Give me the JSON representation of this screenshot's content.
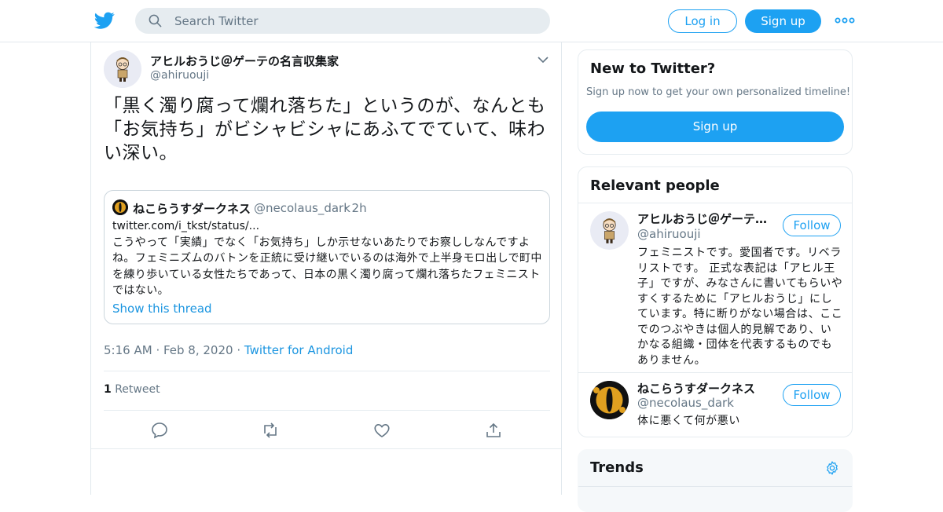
{
  "header": {
    "search_placeholder": "Search Twitter",
    "login_label": "Log in",
    "signup_label": "Sign up",
    "brand_color": "#1da1f2"
  },
  "tweet": {
    "author_name": "アヒルおうじ＠ゲーテの名言収集家",
    "author_handle": "@ahiruouji",
    "text": "「黒く濁り腐って爛れ落ちた」というのが、なんとも「お気持ち」がビシャビシャにあふてでていて、味わい深い。",
    "quote": {
      "author_name": "ねこらうすダークネス",
      "author_handle": "@necolaus_dark",
      "time": "2h",
      "link": "twitter.com/i_tkst/status/...",
      "text": "こうやって「実績」でなく「お気持ち」しか示せないあたりでお察ししなんですよね。フェミニズムのバトンを正統に受け継いでいるのは海外で上半身モロ出しで町中を練り歩いている女性たちであって、日本の黒く濁り腐って爛れ落ちたフェミニストではない。",
      "show_thread": "Show this thread"
    },
    "time": "5:16 AM",
    "date": "Feb 8, 2020",
    "source": "Twitter for Android",
    "retweet_count": "1",
    "retweet_label": "Retweet"
  },
  "sidebar": {
    "new_card": {
      "title": "New to Twitter?",
      "subtitle": "Sign up now to get your own personalized timeline!",
      "button": "Sign up"
    },
    "relevant": {
      "title": "Relevant people",
      "people": [
        {
          "name": "アヒルおうじ＠ゲーテ…",
          "handle": "@ahiruouji",
          "follow": "Follow",
          "bio": "フェミニストです。愛国者です。リベラリストです。 正式な表記は「アヒル王子」ですが、みなさんに書いてもらいやすくするために「アヒルおうじ」にしています。特に断りがない場合は、ここでのつぶやきは個人的見解であり、いかなる組織・団体を代表するものでもありません。"
        },
        {
          "name": "ねこらうすダークネス",
          "handle": "@necolaus_dark",
          "follow": "Follow",
          "bio": "体に悪くて何が悪い"
        }
      ]
    },
    "trends": {
      "title": "Trends"
    }
  }
}
